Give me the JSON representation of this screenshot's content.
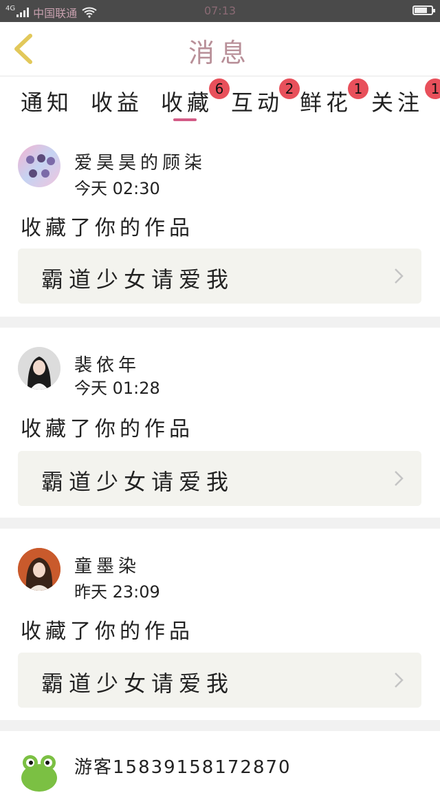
{
  "status_bar": {
    "network": "4G",
    "carrier": "中国联通",
    "time": "07:13",
    "battery_level": 0.7
  },
  "header": {
    "title": "消息",
    "back_icon": "chevron-left-icon"
  },
  "tabs": [
    {
      "label": "通知",
      "badge": ""
    },
    {
      "label": "收益",
      "badge": ""
    },
    {
      "label": "收藏",
      "badge": "6",
      "active": true
    },
    {
      "label": "互动",
      "badge": "2"
    },
    {
      "label": "鲜花",
      "badge": "1"
    },
    {
      "label": "关注",
      "badge": "1"
    }
  ],
  "colors": {
    "accent": "#d35b86",
    "badge": "#e8505b",
    "title": "#b88f98",
    "box_bg": "#f3f3ee"
  },
  "feed": [
    {
      "name": "爱昊昊的顾柒",
      "time": "今天 02:30",
      "action": "收藏了你的作品",
      "work": "霸道少女请爱我"
    },
    {
      "name": "裴依年",
      "time": "今天 01:28",
      "action": "收藏了你的作品",
      "work": "霸道少女请爱我"
    },
    {
      "name": "童墨染",
      "time": "昨天 23:09",
      "action": "收藏了你的作品",
      "work": "霸道少女请爱我"
    },
    {
      "name": "游客15839158172870",
      "time": "",
      "action": "",
      "work": ""
    }
  ]
}
